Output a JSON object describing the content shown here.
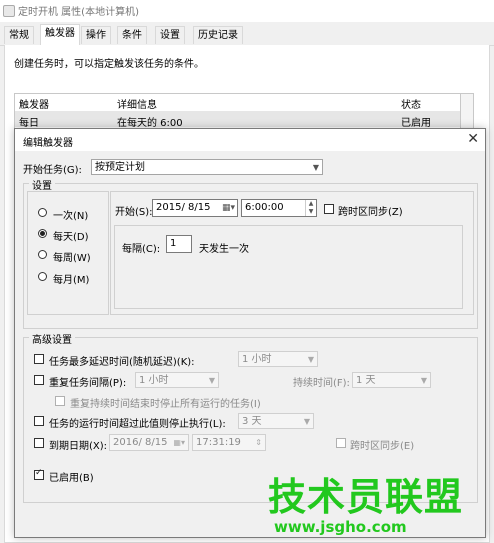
{
  "parent": {
    "title": "定时开机 属性(本地计算机)",
    "tabs": [
      "常规",
      "触发器",
      "操作",
      "条件",
      "设置",
      "历史记录"
    ],
    "active_tab": "触发器",
    "description": "创建任务时，可以指定触发该任务的条件。",
    "table": {
      "headers": [
        "触发器",
        "详细信息",
        "状态"
      ],
      "row": [
        "每日",
        "在每天的 6:00",
        "已启用"
      ]
    }
  },
  "dialog": {
    "title": "编辑触发器",
    "close_glyph": "✕",
    "start_task_label": "开始任务(G):",
    "start_task_value": "按预定计划",
    "settings_label": "设置",
    "radios": [
      "一次(N)",
      "每天(D)",
      "每周(W)",
      "每月(M)"
    ],
    "radio_selected": "每天(D)",
    "start_label": "开始(S):",
    "start_date": "2015/ 8/15",
    "start_time": "6:00:00",
    "sync_tz_label": "跨时区同步(Z)",
    "every_label": "每隔(C):",
    "every_value": "1",
    "every_unit": "天发生一次",
    "advanced_label": "高级设置",
    "delay_label": "任务最多延迟时间(随机延迟)(K):",
    "delay_value": "1 小时",
    "repeat_label": "重复任务间隔(P):",
    "repeat_value": "1 小时",
    "duration_label": "持续时间(F):",
    "duration_value": "1 天",
    "stop_all_label": "重复持续时间结束时停止所有运行的任务(I)",
    "stop_if_label": "任务的运行时间超过此值则停止执行(L):",
    "stop_if_value": "3 天",
    "expire_label": "到期日期(X):",
    "expire_date": "2016/ 8/15",
    "expire_time": "17:31:19",
    "expire_sync_label": "跨时区同步(E)",
    "enabled_label": "已启用(B)"
  },
  "watermark": {
    "main": "技术员联盟",
    "url": "www.jsgho.com"
  }
}
